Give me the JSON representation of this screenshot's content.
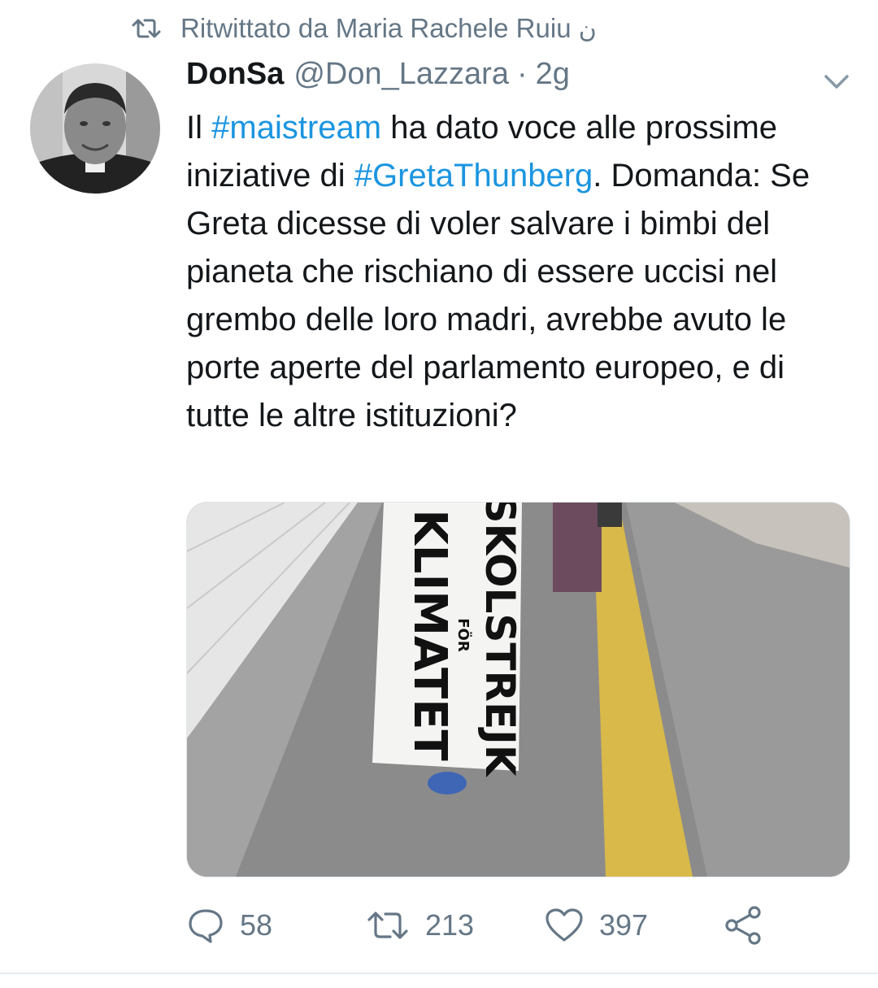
{
  "retweet": {
    "label": "Ritwittato da Maria Rachele Ruiu",
    "suffix": "ن",
    "icon": "retweet-icon"
  },
  "tweet": {
    "author": {
      "name": "DonSa",
      "handle": "@Don_Lazzara",
      "separator": "·",
      "time": "2g"
    },
    "text": {
      "p1": "Il ",
      "hashtag1": "#maistream",
      "p2": " ha dato voce alle prossime iniziative di ",
      "hashtag2": "#GretaThunberg",
      "p3": ". Domanda: Se Greta dicesse di voler salvare i bimbi del pianeta che rischiano di essere uccisi nel grembo delle loro madri, avrebbe avuto le porte aperte del parlamento europeo, e di tutte le altre istituzioni?"
    },
    "media": {
      "sign_line1": "SKOLSTREJK",
      "sign_line2": "FÖR",
      "sign_line3": "KLIMATET"
    },
    "actions": {
      "replies": "58",
      "retweets": "213",
      "likes": "397"
    }
  },
  "colors": {
    "link": "#1b95e0",
    "secondary_text": "#657786",
    "primary_text": "#14171a"
  }
}
